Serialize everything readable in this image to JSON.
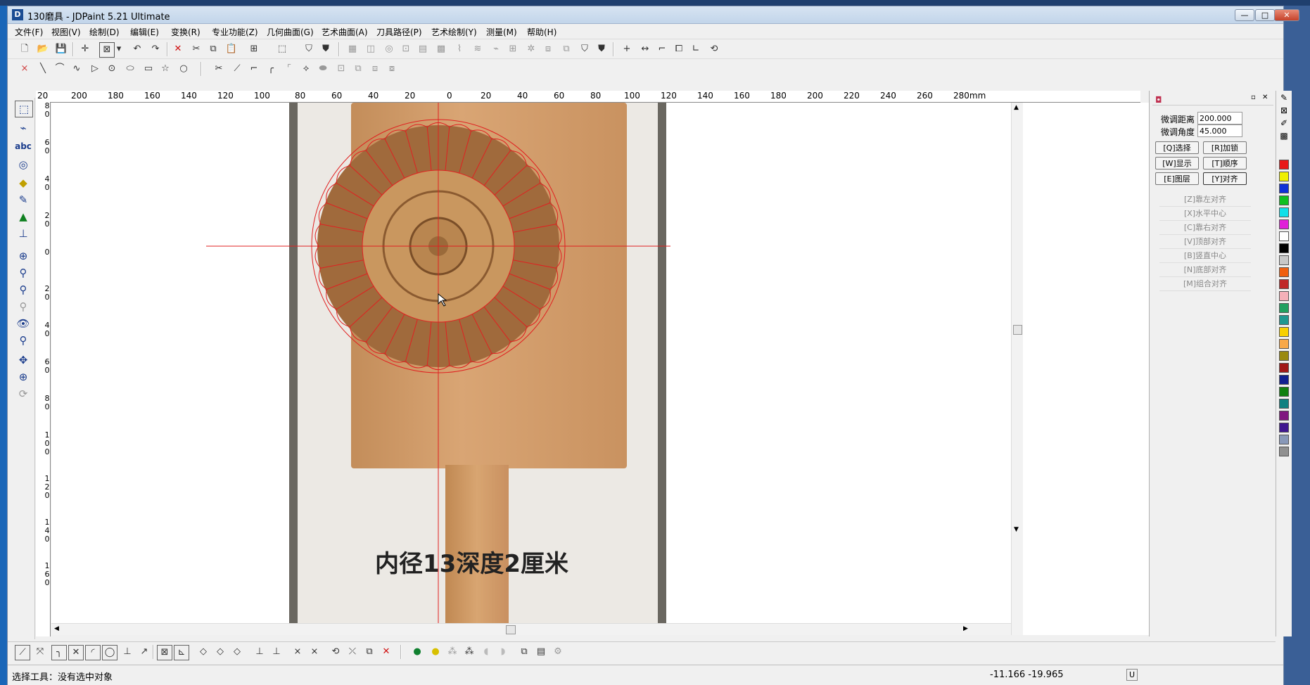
{
  "window": {
    "title": "130磨具 - JDPaint 5.21 Ultimate",
    "app_icon": "D",
    "minimize": "—",
    "maximize": "□",
    "close": "✕"
  },
  "menu": [
    "文件(F)",
    "视图(V)",
    "绘制(D)",
    "编辑(E)",
    "变换(R)",
    "专业功能(Z)",
    "几何曲面(G)",
    "艺术曲面(A)",
    "刀具路径(P)",
    "艺术绘制(Y)",
    "测量(M)",
    "帮助(H)"
  ],
  "hruler_labels": [
    "20",
    "200",
    "180",
    "160",
    "140",
    "120",
    "100",
    "80",
    "60",
    "40",
    "20",
    "0",
    "20",
    "40",
    "60",
    "80",
    "100",
    "120",
    "140",
    "160",
    "180",
    "200",
    "220",
    "240",
    "260",
    "280mm"
  ],
  "vruler_labels": [
    "8",
    "0",
    "6",
    "0",
    "4",
    "0",
    "2",
    "0",
    "0",
    "2",
    "0",
    "4",
    "0",
    "6",
    "0",
    "8",
    "0",
    "1",
    "0",
    "0",
    "1",
    "2",
    "0",
    "1",
    "4",
    "0",
    "1",
    "6",
    "0"
  ],
  "canvas": {
    "caption": "内径13深度2厘米",
    "crosshair_color": "#e02020",
    "mold_rings": 34
  },
  "right_panel": {
    "fine_distance_label": "微调距离",
    "fine_distance_value": "200.000",
    "fine_angle_label": "微调角度",
    "fine_angle_value": "45.000",
    "buttons": [
      "[Q]选择",
      "[R]加锁",
      "[W]显示",
      "[T]顺序",
      "[E]图层",
      "[Y]对齐"
    ],
    "align_options": [
      "[Z]靠左对齐",
      "[X]水平中心",
      "[C]靠右对齐",
      "[V]顶部对齐",
      "[B]竖直中心",
      "[N]底部对齐",
      "[M]组合对齐"
    ]
  },
  "palette": [
    "#e81818",
    "#f0f000",
    "#1030d8",
    "#10c020",
    "#10e0e8",
    "#e020d8",
    "#ffffff",
    "#000000",
    "#c8c8c8",
    "#f06010",
    "#c02828",
    "#f4b0b8",
    "#20a060",
    "#209890",
    "#f8d000",
    "#f8a848",
    "#9a8a10",
    "#a01818",
    "#102090",
    "#108010",
    "#108080",
    "#801880",
    "#401890",
    "#8898b8",
    "#909090"
  ],
  "status": {
    "text": "选择工具：没有选中对象",
    "coords": "-11.166  -19.965",
    "unit_box": "U"
  }
}
